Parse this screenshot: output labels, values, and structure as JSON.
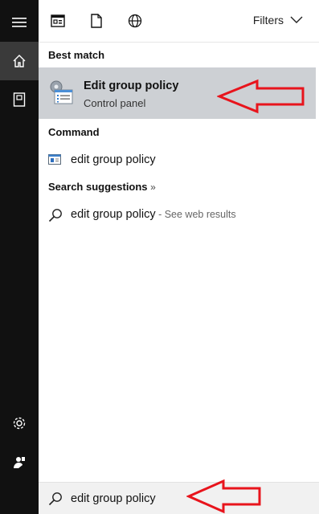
{
  "topbar": {
    "filters_label": "Filters",
    "icons": [
      "apps-icon",
      "document-icon",
      "globe-icon"
    ]
  },
  "sections": {
    "best_match_label": "Best match",
    "command_label": "Command",
    "suggestions_label": "Search suggestions",
    "suggestions_chevron": "»"
  },
  "best_match": {
    "title": "Edit group policy",
    "subtitle": "Control panel",
    "icon": "group-policy-icon"
  },
  "command": {
    "text": "edit group policy",
    "icon": "console-icon"
  },
  "suggestion": {
    "text": "edit group policy",
    "note": " - See web results",
    "icon": "search-icon"
  },
  "search": {
    "value": "edit group policy",
    "placeholder": ""
  },
  "rail": {
    "items": [
      "menu-icon",
      "home-icon",
      "notebook-icon",
      "settings-icon",
      "feedback-icon"
    ]
  },
  "colors": {
    "rail_bg": "#111111",
    "selected_row_bg": "#cdd0d4",
    "annotation_red": "#e8141c"
  }
}
